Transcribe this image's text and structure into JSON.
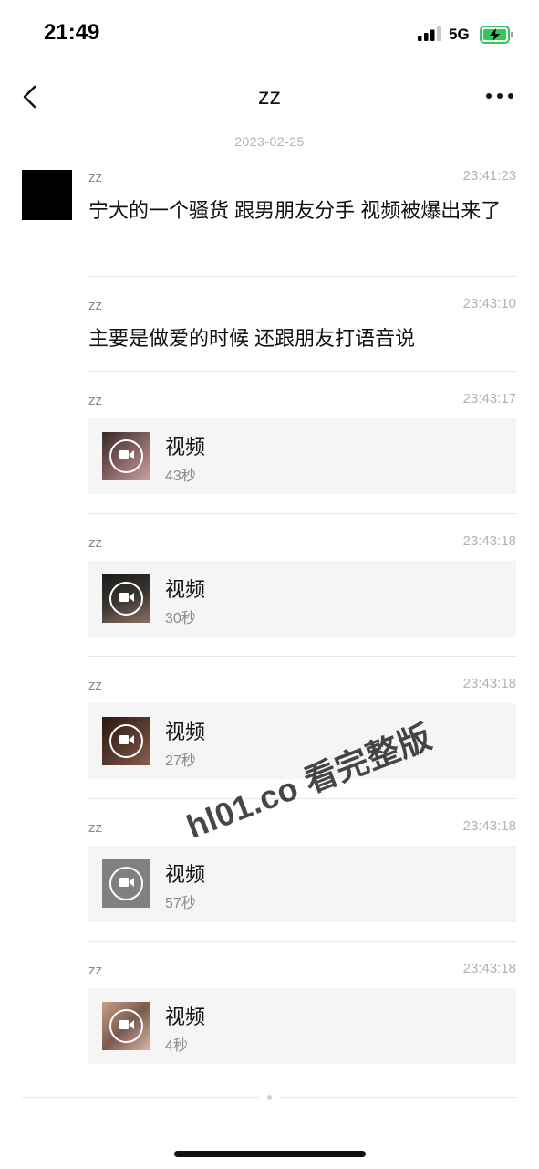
{
  "status_bar": {
    "time": "21:49",
    "network": "5G",
    "icons": [
      "signal-icon",
      "battery-charging-icon"
    ]
  },
  "nav": {
    "title": "zz",
    "back_icon": "chevron-left-icon",
    "more_icon": "more-dots-icon"
  },
  "date_divider": "2023-02-25",
  "messages": [
    {
      "type": "text",
      "sender": "zz",
      "time": "23:41:23",
      "text": "宁大的一个骚货 跟男朋友分手 视频被爆出来了"
    },
    {
      "type": "text",
      "sender": "zz",
      "time": "23:43:10",
      "text": "主要是做爱的时候 还跟朋友打语音说"
    },
    {
      "type": "video",
      "sender": "zz",
      "time": "23:43:17",
      "title": "视频",
      "duration": "43秒"
    },
    {
      "type": "video",
      "sender": "zz",
      "time": "23:43:18",
      "title": "视频",
      "duration": "30秒"
    },
    {
      "type": "video",
      "sender": "zz",
      "time": "23:43:18",
      "title": "视频",
      "duration": "27秒"
    },
    {
      "type": "video",
      "sender": "zz",
      "time": "23:43:18",
      "title": "视频",
      "duration": "57秒"
    },
    {
      "type": "video",
      "sender": "zz",
      "time": "23:43:18",
      "title": "视频",
      "duration": "4秒"
    }
  ],
  "watermark": "hl01.co 看完整版",
  "colors": {
    "background": "#ffffff",
    "card": "#f5f5f5",
    "meta_text": "#b2b2b2",
    "battery": "#34c759"
  }
}
